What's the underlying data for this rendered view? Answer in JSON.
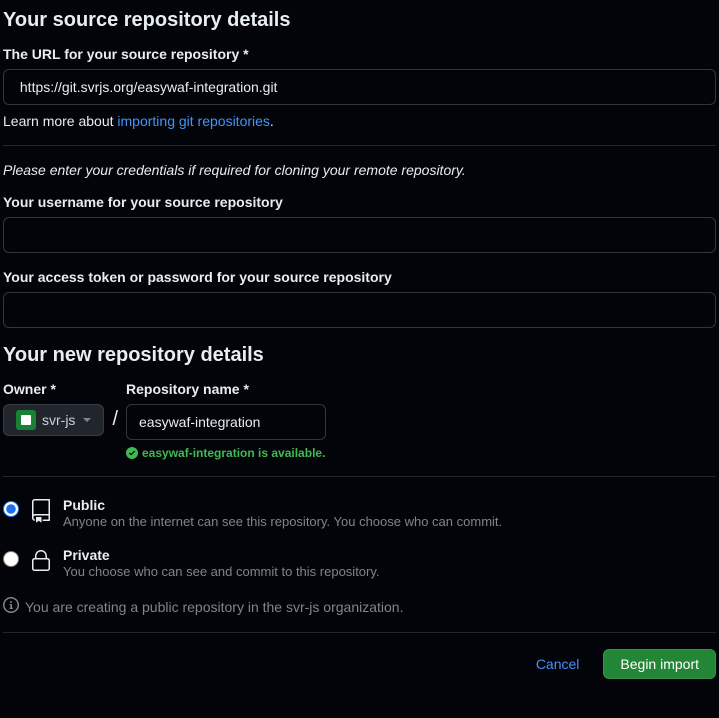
{
  "source": {
    "heading": "Your source repository details",
    "url_label": "The URL for your source repository",
    "url_value": " https://git.svrjs.org/easywaf-integration.git",
    "learn_prefix": "Learn more about ",
    "learn_link": "importing git repositories",
    "learn_suffix": ".",
    "credentials_note": "Please enter your credentials if required for cloning your remote repository.",
    "username_label": "Your username for your source repository",
    "username_value": "",
    "password_label": "Your access token or password for your source repository",
    "password_value": ""
  },
  "newrepo": {
    "heading": "Your new repository details",
    "owner_label": "Owner",
    "owner_value": "svr-js",
    "repo_label": "Repository name",
    "repo_value": "easywaf-integration",
    "availability_text": "easywaf-integration is available."
  },
  "visibility": {
    "public": {
      "title": "Public",
      "desc": "Anyone on the internet can see this repository. You choose who can commit."
    },
    "private": {
      "title": "Private",
      "desc": "You choose who can see and commit to this repository."
    }
  },
  "info_text": "You are creating a public repository in the svr-js organization.",
  "footer": {
    "cancel": "Cancel",
    "submit": "Begin import"
  }
}
